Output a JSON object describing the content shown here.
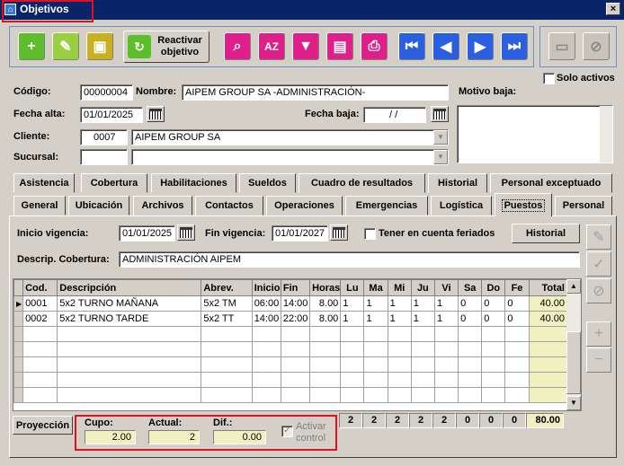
{
  "window": {
    "title": "Objetivos",
    "close_label": "×"
  },
  "toolbar": {
    "reactivar_label": "Reactivar objetivo",
    "solo_activos_label": "Solo activos"
  },
  "header": {
    "codigo_label": "Código:",
    "codigo_value": "00000004",
    "nombre_label": "Nombre:",
    "nombre_value": "AIPEM GROUP SA -ADMINISTRACIÓN-",
    "motivo_label": "Motivo baja:",
    "fecha_alta_label": "Fecha alta:",
    "fecha_alta_value": "01/01/2025",
    "fecha_baja_label": "Fecha baja:",
    "fecha_baja_value": "/ /",
    "cliente_label": "Cliente:",
    "cliente_code": "0007",
    "cliente_name": "AIPEM GROUP SA",
    "sucursal_label": "Sucursal:",
    "sucursal_code": "",
    "sucursal_name": ""
  },
  "tabs_row1": [
    "Asistencia",
    "Cobertura",
    "Habilitaciones",
    "Sueldos",
    "Cuadro de resultados",
    "Historial",
    "Personal exceptuado"
  ],
  "tabs_row2": [
    "General",
    "Ubicación",
    "Archivos",
    "Contactos",
    "Operaciones",
    "Emergencias",
    "Logística",
    "Puestos",
    "Personal"
  ],
  "puestos": {
    "inicio_label": "Inicio vigencia:",
    "inicio_value": "01/01/2025",
    "fin_label": "Fin vigencia:",
    "fin_value": "01/01/2027",
    "feriados_label": "Tener en cuenta feriados",
    "historial_label": "Historial",
    "descrip_label": "Descrip. Cobertura:",
    "descrip_value": "ADMINISTRACIÓN AIPEM"
  },
  "grid": {
    "columns": [
      "Cod.",
      "Descripción",
      "Abrev.",
      "Inicio",
      "Fin",
      "Horas",
      "Lu",
      "Ma",
      "Mi",
      "Ju",
      "Vi",
      "Sa",
      "Do",
      "Fe",
      "Total"
    ],
    "rows": [
      [
        "0001",
        "5x2 TURNO MAÑANA",
        "5x2 TM",
        "06:00",
        "14:00",
        "8.00",
        "1",
        "1",
        "1",
        "1",
        "1",
        "0",
        "0",
        "0",
        "40.00"
      ],
      [
        "0002",
        "5x2 TURNO TARDE",
        "5x2 TT",
        "14:00",
        "22:00",
        "8.00",
        "1",
        "1",
        "1",
        "1",
        "1",
        "0",
        "0",
        "0",
        "40.00"
      ]
    ],
    "totals": [
      "2",
      "2",
      "2",
      "2",
      "2",
      "0",
      "0",
      "0",
      "80.00"
    ]
  },
  "footer": {
    "proyeccion_label": "Proyección",
    "cupo_label": "Cupo:",
    "cupo_value": "2.00",
    "actual_label": "Actual:",
    "actual_value": "2",
    "dif_label": "Dif.:",
    "dif_value": "0.00",
    "activar_label": "Activar control"
  }
}
